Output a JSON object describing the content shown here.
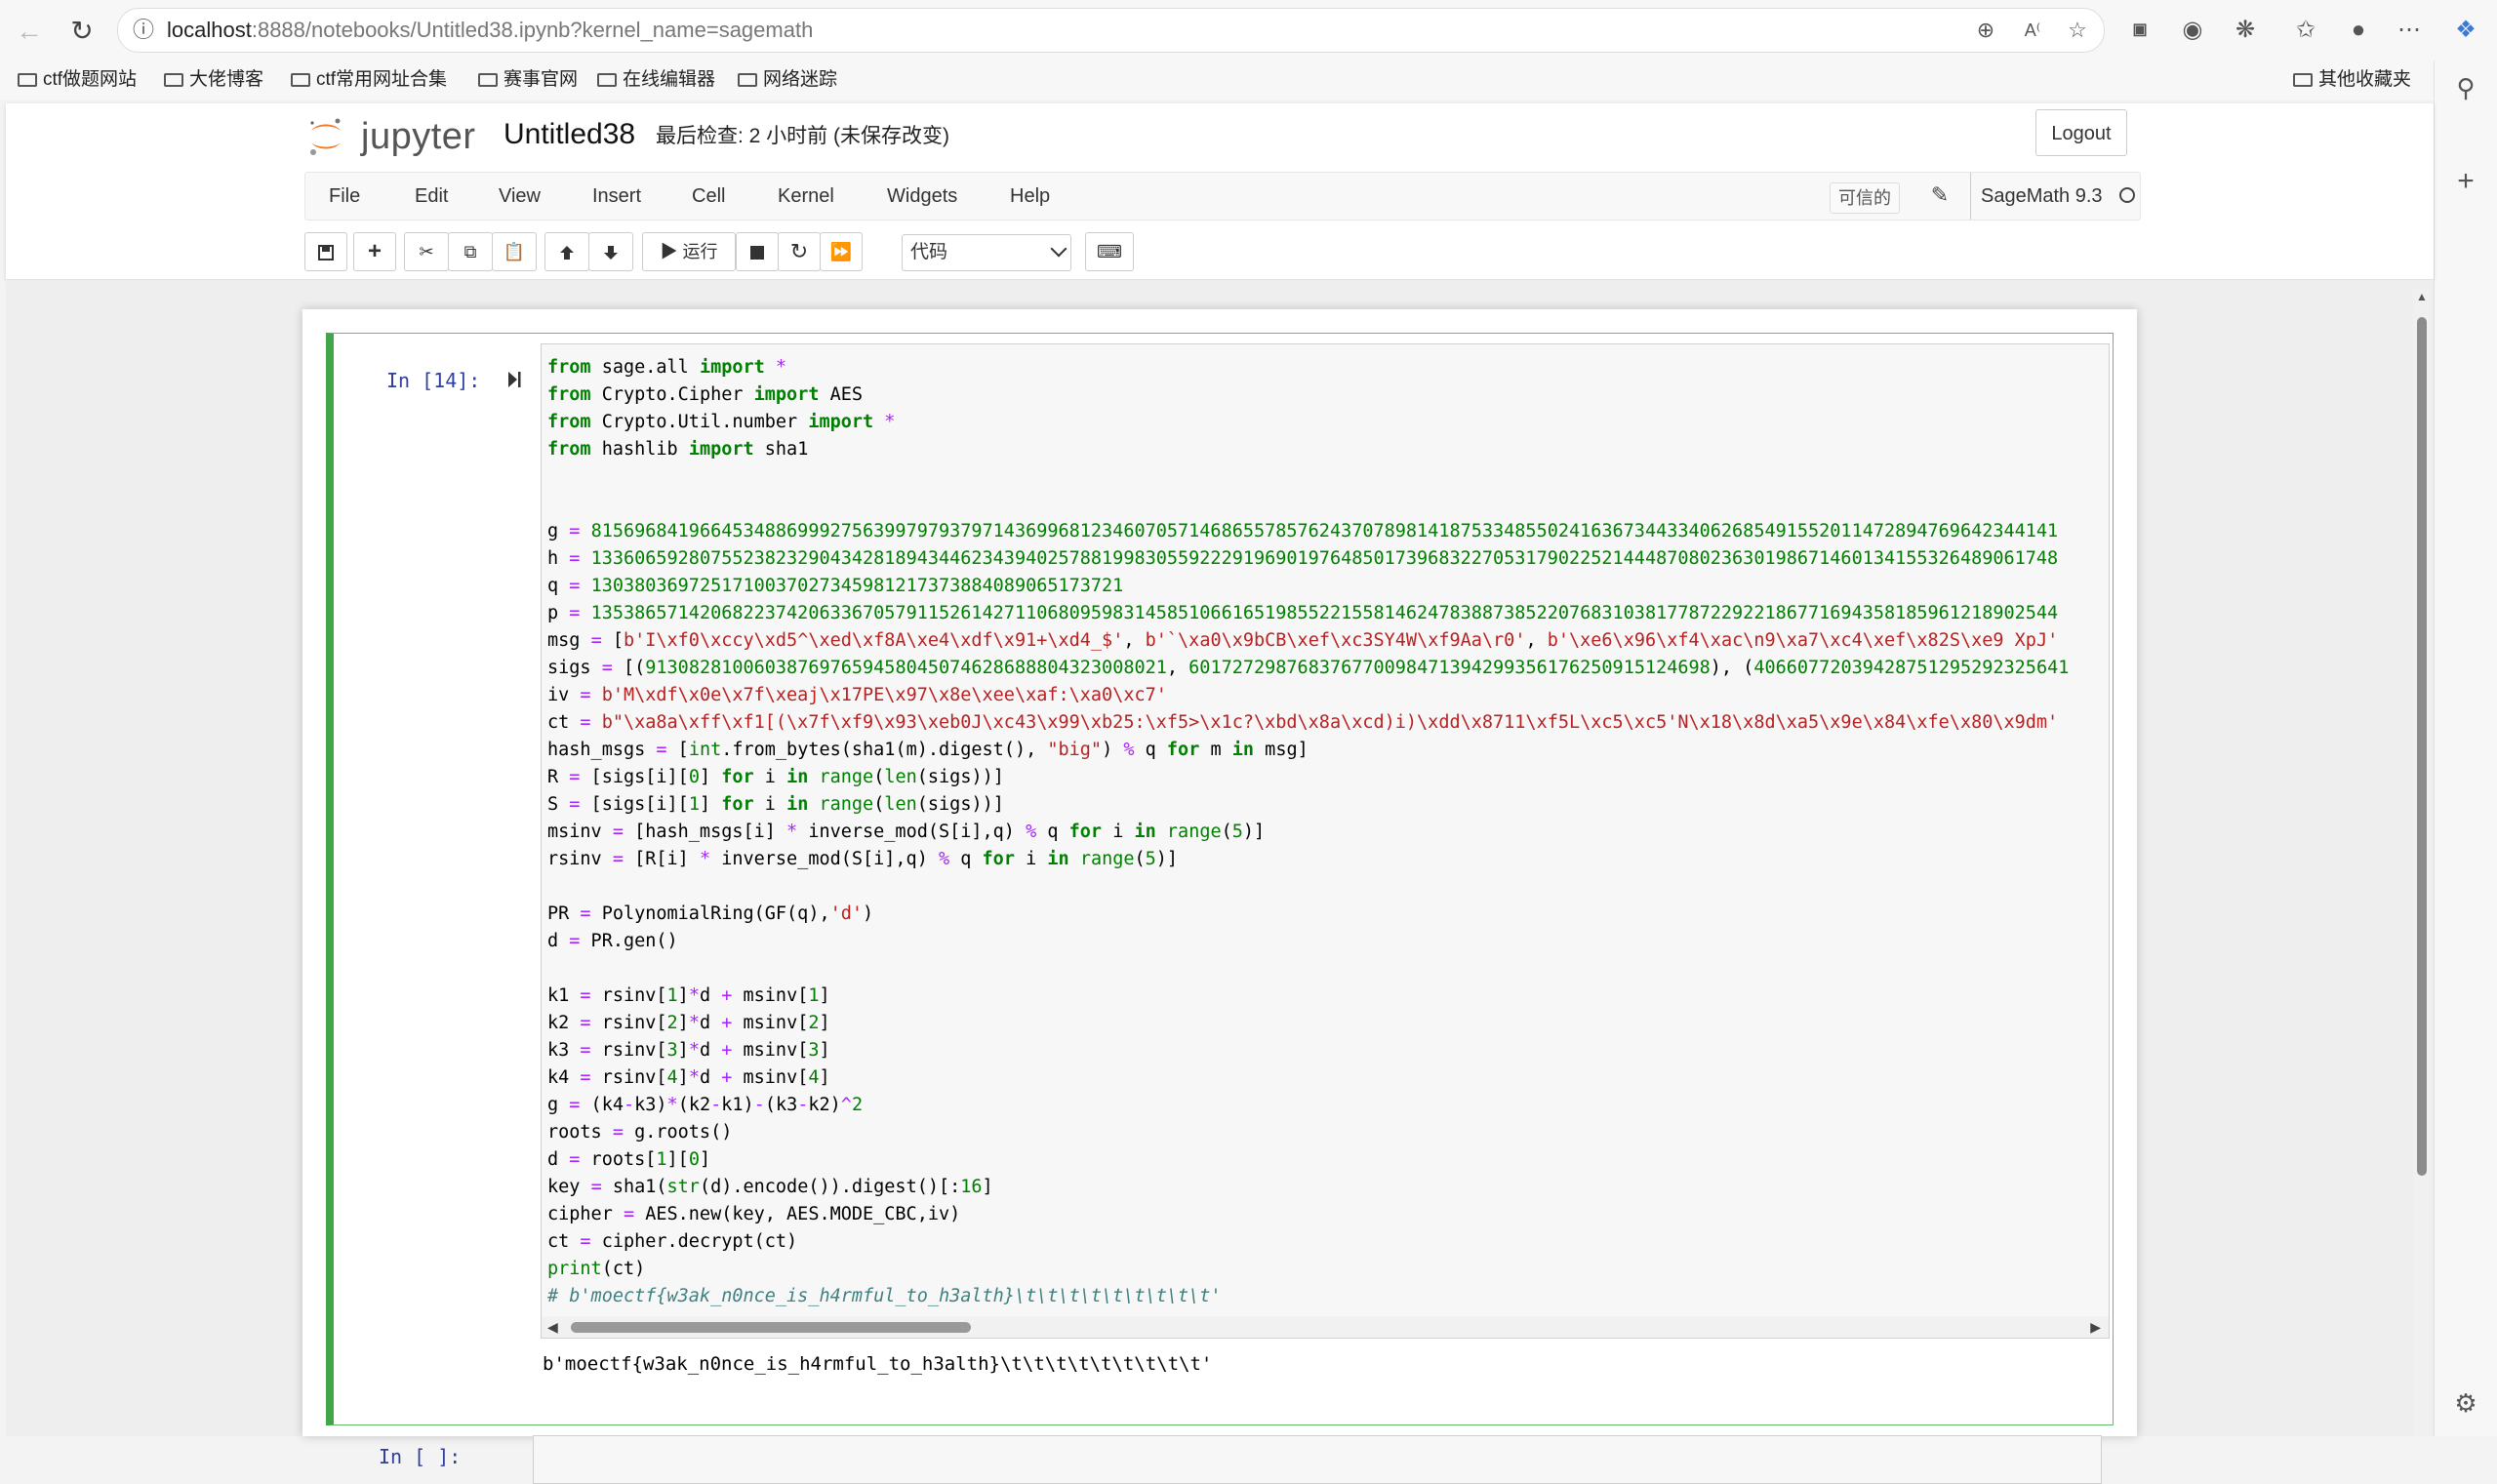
{
  "browser": {
    "url_host": "localhost",
    "url_rest": ":8888/notebooks/Untitled38.ipynb?kernel_name=sagemath"
  },
  "bookmarks": [
    {
      "label": "ctf做题网站"
    },
    {
      "label": "大佬博客"
    },
    {
      "label": "ctf常用网址合集"
    },
    {
      "label": "赛事官网"
    },
    {
      "label": "在线编辑器"
    },
    {
      "label": "网络迷踪"
    }
  ],
  "other_bookmarks": "其他收藏夹",
  "jupyter": {
    "logo_text": "jupyter",
    "title": "Untitled38",
    "checkpoint": "最后检查: 2 小时前  (未保存改变)",
    "logout": "Logout",
    "menu": [
      "File",
      "Edit",
      "View",
      "Insert",
      "Cell",
      "Kernel",
      "Widgets",
      "Help"
    ],
    "trusted": "可信的",
    "kernel": "SageMath 9.3",
    "run_label": "运行",
    "cell_type": "代码"
  },
  "cell1": {
    "prompt": "In  [14]:",
    "output": "b'moectf{w3ak_n0nce_is_h4rmful_to_h3alth}\\t\\t\\t\\t\\t\\t\\t\\t\\t'"
  },
  "cell2": {
    "prompt": "In  [ ]:"
  },
  "colors": {
    "cell_border": "#42a548",
    "prompt": "#303f9f",
    "keyword": "#008000",
    "string": "#ba2121",
    "operator": "#aa22ff"
  }
}
